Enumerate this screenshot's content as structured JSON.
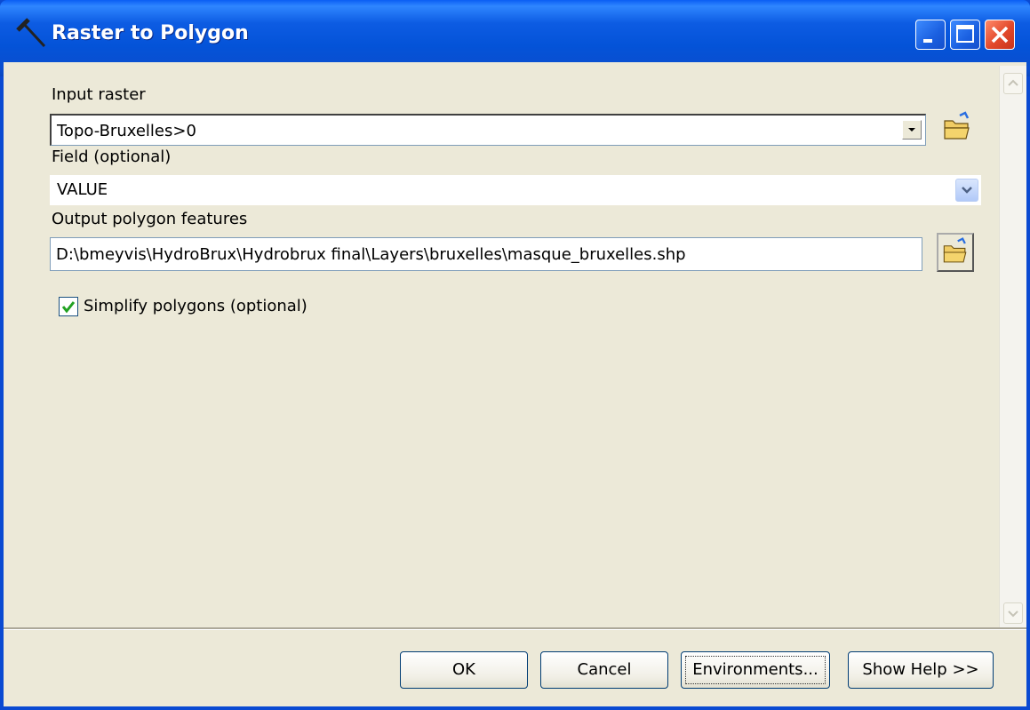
{
  "window": {
    "title": "Raster to Polygon",
    "icon": "hammer-tool-icon"
  },
  "form": {
    "input_raster": {
      "label": "Input raster",
      "value": "Topo-Bruxelles>0"
    },
    "field": {
      "label": "Field (optional)",
      "value": "VALUE"
    },
    "output": {
      "label": "Output polygon features",
      "value": "D:\\bmeyvis\\HydroBrux\\Hydrobrux final\\Layers\\bruxelles\\masque_bruxelles.shp"
    },
    "simplify": {
      "label": "Simplify polygons (optional)",
      "checked": true
    }
  },
  "buttons": {
    "ok": "OK",
    "cancel": "Cancel",
    "environments": "Environments...",
    "help": "Show Help >>"
  },
  "colors": {
    "title_bar": "#0a4ad2",
    "dialog_bg": "#ece9d8",
    "close_button": "#e2482a",
    "checkmark": "#21a121"
  }
}
